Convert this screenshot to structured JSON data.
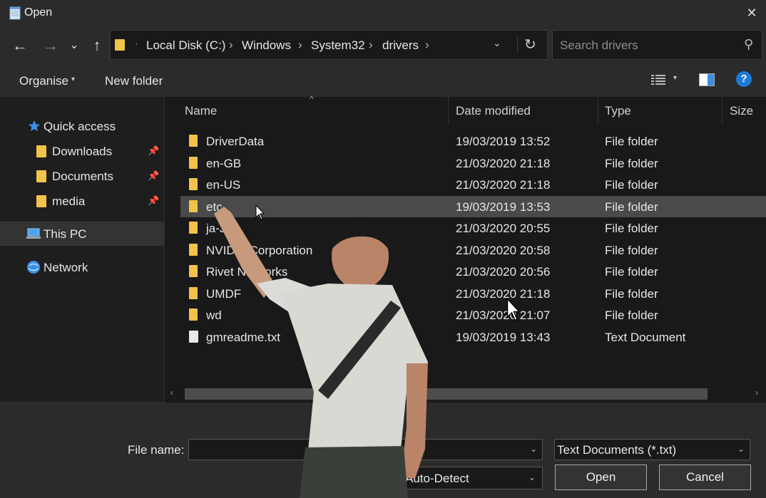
{
  "window": {
    "title": "Open",
    "close_glyph": "✕"
  },
  "nav": {
    "back_glyph": "←",
    "forward_glyph": "→",
    "recent_glyph": "⌄",
    "up_glyph": "↑",
    "breadcrumb": [
      "Local Disk (C:)",
      "Windows",
      "System32",
      "drivers"
    ],
    "separator": "›",
    "dot": "·",
    "dropdown_glyph": "⌄",
    "refresh_glyph": "↻",
    "search_placeholder": "Search drivers",
    "search_glyph": "⚲"
  },
  "toolbar": {
    "organise_label": "Organise",
    "caret": "▾",
    "new_folder_label": "New folder",
    "help_glyph": "?"
  },
  "sidebar": {
    "pin_glyph": "📌",
    "items": [
      {
        "label": "Quick access",
        "icon": "star-icon"
      },
      {
        "label": "Downloads",
        "icon": "folder-icon",
        "pinned": true
      },
      {
        "label": "Documents",
        "icon": "folder-icon",
        "pinned": true
      },
      {
        "label": "media",
        "icon": "folder-icon",
        "pinned": true
      },
      {
        "label": "This PC",
        "icon": "pc-icon",
        "selected": true
      },
      {
        "label": "Network",
        "icon": "network-icon"
      }
    ]
  },
  "list": {
    "sort_glyph": "^",
    "columns": [
      "Name",
      "Date modified",
      "Type",
      "Size"
    ],
    "rows": [
      {
        "name": "DriverData",
        "date": "19/03/2019 13:52",
        "type": "File folder",
        "icon": "folder-icon"
      },
      {
        "name": "en-GB",
        "date": "21/03/2020 21:18",
        "type": "File folder",
        "icon": "folder-icon"
      },
      {
        "name": "en-US",
        "date": "21/03/2020 21:18",
        "type": "File folder",
        "icon": "folder-icon"
      },
      {
        "name": "etc",
        "date": "19/03/2019 13:53",
        "type": "File folder",
        "icon": "folder-icon",
        "selected": true
      },
      {
        "name": "ja-JP",
        "date": "21/03/2020 20:55",
        "type": "File folder",
        "icon": "folder-icon"
      },
      {
        "name": "NVIDIA Corporation",
        "date": "21/03/2020 20:58",
        "type": "File folder",
        "icon": "folder-icon"
      },
      {
        "name": "Rivet Networks",
        "date": "21/03/2020 20:56",
        "type": "File folder",
        "icon": "folder-icon"
      },
      {
        "name": "UMDF",
        "date": "21/03/2020 21:18",
        "type": "File folder",
        "icon": "folder-icon"
      },
      {
        "name": "wd",
        "date": "21/03/2020 21:07",
        "type": "File folder",
        "icon": "folder-icon"
      },
      {
        "name": "gmreadme.txt",
        "date": "19/03/2019 13:43",
        "type": "Text Document",
        "icon": "text-file-icon"
      }
    ]
  },
  "scrollbar": {
    "left_glyph": "‹",
    "right_glyph": "›"
  },
  "footer": {
    "file_name_label": "File name:",
    "file_name_value": "",
    "combo_caret": "⌄",
    "file_type_value": "Text Documents (*.txt)",
    "encoding_value": "Auto-Detect",
    "open_label": "Open",
    "cancel_label": "Cancel"
  },
  "colors": {
    "folder": "#f2c24b",
    "accent": "#1f7ad6",
    "background": "#191919",
    "chrome": "#2b2b2b"
  }
}
